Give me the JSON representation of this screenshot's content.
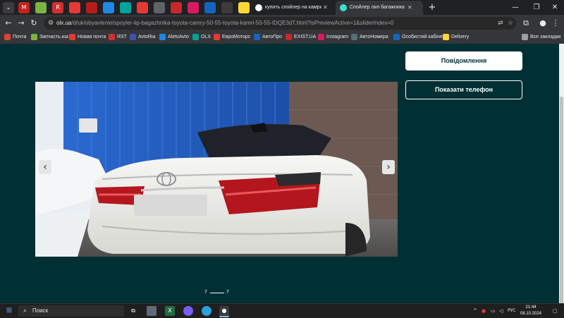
{
  "browser": {
    "tabs": [
      {
        "label": "купить спойлер на камри 55 в",
        "favicon_color": "#ffffff"
      },
      {
        "label": "Спойлер лип багажника Toyota",
        "favicon_color": "#3ae0d2"
      }
    ],
    "new_tab_label": "+",
    "address": {
      "url_domain": "olx.ua",
      "url_path": "/d/uk/obyavlenie/spoyler-lip-bagazhnika-toyota-camry-50-55-toyota-kamri-50-55-IDQE3dT.html?isPreviewActive=1&sliderIndex=0"
    },
    "bookmarks": [
      {
        "label": "Почта",
        "color": "#db4437"
      },
      {
        "label": "Запчасть.юа",
        "color": "#7cb342"
      },
      {
        "label": "Новая почта",
        "color": "#e53935"
      },
      {
        "label": "RST",
        "color": "#d32f2f"
      },
      {
        "label": "AvtoRia",
        "color": "#3f51b5"
      },
      {
        "label": "AletoAvto",
        "color": "#1e88e5"
      },
      {
        "label": "OLX",
        "color": "#00a49f"
      },
      {
        "label": "ЕвроМоторс",
        "color": "#e53935"
      },
      {
        "label": "АвтоПро",
        "color": "#1565c0"
      },
      {
        "label": "EXIST.UA",
        "color": "#c62828"
      },
      {
        "label": "Instagram",
        "color": "#d81b60"
      },
      {
        "label": "АвтоНомера",
        "color": "#546e7a"
      },
      {
        "label": "Особистий кабінет",
        "color": "#1565c0"
      },
      {
        "label": "Delivery",
        "color": "#fdd835"
      }
    ],
    "all_bookmarks_label": "Все закладки"
  },
  "listing": {
    "message_button": "Повідомлення",
    "phone_button": "Показати телефон",
    "gallery": {
      "current": "7",
      "total": "7"
    }
  },
  "taskbar": {
    "search_placeholder": "Поиск",
    "language": "РУС",
    "time": "21:44",
    "date": "08.10.2024"
  }
}
